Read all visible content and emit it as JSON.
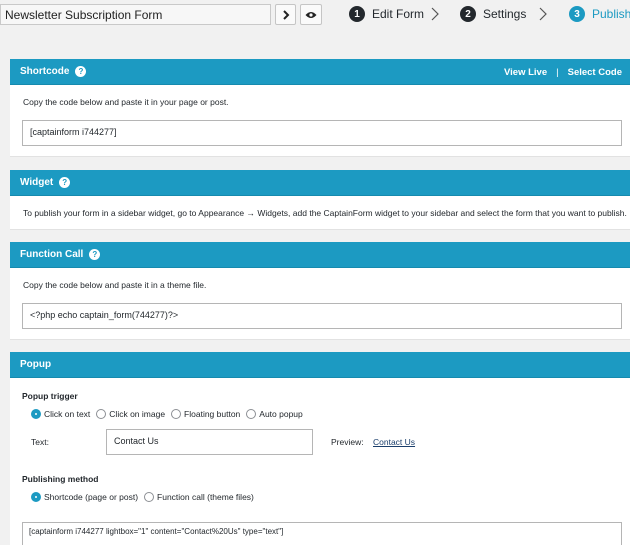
{
  "header": {
    "form_name": "Newsletter Subscription Form",
    "go_icon": "chevron-right-icon",
    "preview_icon": "eye-icon",
    "steps": [
      {
        "number": "1",
        "label": "Edit Form",
        "active": false
      },
      {
        "number": "2",
        "label": "Settings",
        "active": false
      },
      {
        "number": "3",
        "label": "Publish",
        "active": true
      }
    ]
  },
  "shortcode": {
    "title": "Shortcode",
    "view_live": "View Live",
    "separator": "|",
    "select_code": "Select Code",
    "description": "Copy the code below and paste it in your page or post.",
    "code": "[captainform i744277]"
  },
  "widget": {
    "title": "Widget",
    "description": "To publish your form in a sidebar widget, go to Appearance → Widgets, add the CaptainForm widget to your sidebar and select the form that you want to publish."
  },
  "function_call": {
    "title": "Function Call",
    "description": "Copy the code below and paste it in a theme file.",
    "code": "<?php echo captain_form(744277)?>"
  },
  "popup": {
    "title": "Popup",
    "trigger_label": "Popup trigger",
    "trigger_options": [
      {
        "label": "Click on text",
        "checked": true
      },
      {
        "label": "Click on image",
        "checked": false
      },
      {
        "label": "Floating button",
        "checked": false
      },
      {
        "label": "Auto popup",
        "checked": false
      }
    ],
    "text_label": "Text:",
    "text_value": "Contact Us",
    "preview_label": "Preview:",
    "preview_link": "Contact Us",
    "method_label": "Publishing method",
    "method_options": [
      {
        "label": "Shortcode (page or post)",
        "checked": true
      },
      {
        "label": "Function call (theme files)",
        "checked": false
      }
    ],
    "code": "[captainform i744277 lightbox=\"1\" content=\"Contact%20Us\" type=\"text\"]"
  },
  "colors": {
    "accent": "#1c9ac2",
    "background": "#f1f1f1",
    "step_dark": "#23282d"
  }
}
